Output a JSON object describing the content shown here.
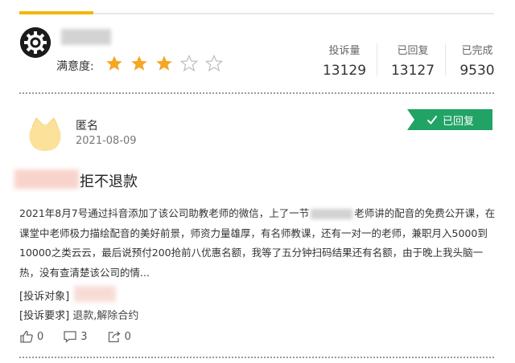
{
  "company": {
    "satisfaction_label": "满意度:",
    "stars": {
      "rating": 3,
      "max": 5
    }
  },
  "stats": [
    {
      "label": "投诉量",
      "value": "13129"
    },
    {
      "label": "已回复",
      "value": "13127"
    },
    {
      "label": "已完成",
      "value": "9530"
    }
  ],
  "complaint": {
    "author": "匿名",
    "date": "2021-08-09",
    "badge": "已回复",
    "title": "拒不退款",
    "body_part1": "2021年8月7号通过抖音添加了该公司助教老师的微信，上了一节",
    "body_part2": "老师讲的配音的免费公开课，在课堂中老师极力描绘配音的美好前景，师资力量雄厚，有名师教课，还有一对一的老师，兼职月入5000到10000之类云云，最后说预付200抢前八优惠名额，我等了五分钟扫码结果还有名额，由于晚上我头脑一热，没有查清楚该公司的情...",
    "target_label": "[投诉对象]",
    "demand_label": "[投诉要求]",
    "demand_value": "退款,解除合约",
    "likes": "0",
    "comments": "3",
    "shares": "0"
  },
  "colors": {
    "accent": "#f2b705",
    "star_filled": "#f5a623",
    "badge_green": "#21a366"
  },
  "icons": {
    "logo": "company-logo-icon",
    "avatar": "cat-avatar-icon",
    "check": "check-icon",
    "like": "thumbs-up-icon",
    "comment": "comment-icon",
    "share": "share-icon"
  }
}
